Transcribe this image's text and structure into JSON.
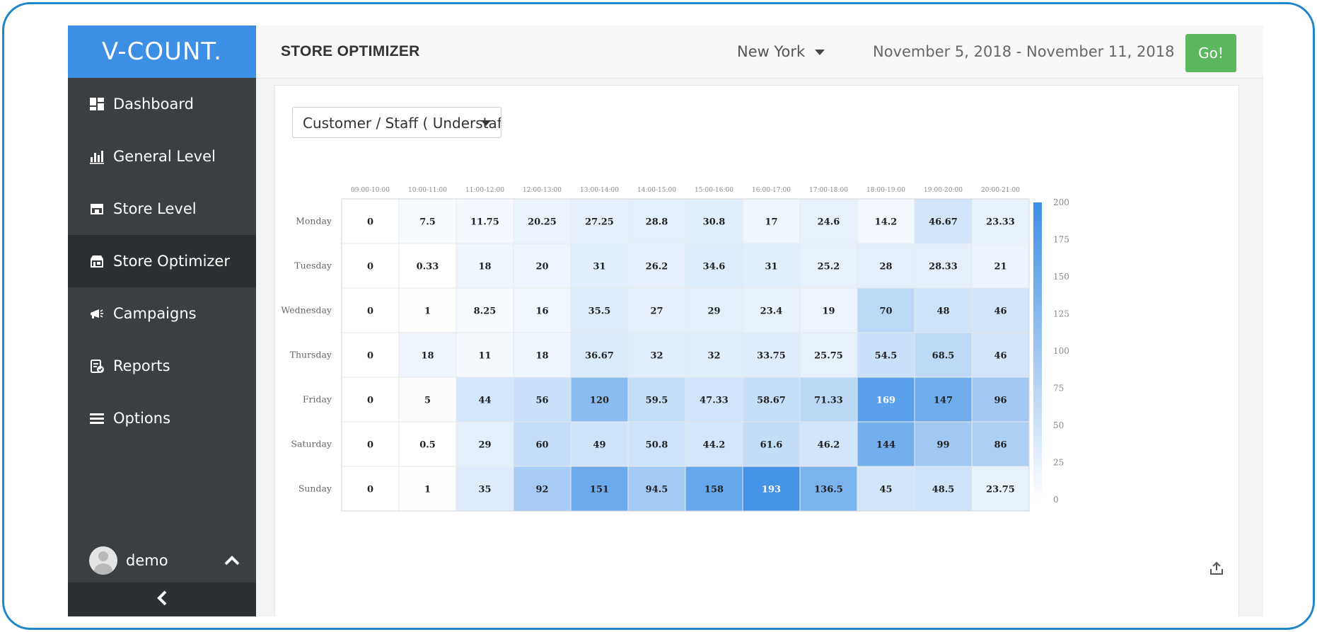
{
  "app": {
    "logo": "V-COUNT.",
    "title": "STORE OPTIMIZER",
    "location": "New York",
    "date_range": "November 5, 2018 - November 11, 2018",
    "go_label": "Go!"
  },
  "sidebar": {
    "items": [
      {
        "label": "Dashboard",
        "icon": "dashboard-icon"
      },
      {
        "label": "General Level",
        "icon": "bar-chart-icon"
      },
      {
        "label": "Store Level",
        "icon": "store-icon"
      },
      {
        "label": "Store Optimizer",
        "icon": "store-optimizer-icon",
        "active": true
      },
      {
        "label": "Campaigns",
        "icon": "megaphone-icon"
      },
      {
        "label": "Reports",
        "icon": "report-icon"
      },
      {
        "label": "Options",
        "icon": "menu-icon"
      }
    ],
    "user": "demo"
  },
  "controls": {
    "metric": "Customer / Staff ( Understaffed"
  },
  "colors": {
    "brand": "#3d8fe6",
    "go": "#5cb85c",
    "sidebar": "#3b3f42",
    "heat_min": "#ffffff",
    "heat_max": "#3d8fe6"
  },
  "chart_data": {
    "type": "heatmap",
    "x": [
      "09:00-10:00",
      "10:00-11:00",
      "11:00-12:00",
      "12:00-13:00",
      "13:00-14:00",
      "14:00-15:00",
      "15:00-16:00",
      "16:00-17:00",
      "17:00-18:00",
      "18:00-19:00",
      "19:00-20:00",
      "20:00-21:00"
    ],
    "y": [
      "Monday",
      "Tuesday",
      "Wednesday",
      "Thursday",
      "Friday",
      "Saturday",
      "Sunday"
    ],
    "values": [
      [
        0,
        7.5,
        11.75,
        20.25,
        27.25,
        28.8,
        30.8,
        17,
        24.6,
        14.2,
        46.67,
        23.33
      ],
      [
        0,
        0.33,
        18,
        20,
        31,
        26.2,
        34.6,
        31,
        25.2,
        28,
        28.33,
        21
      ],
      [
        0,
        1,
        8.25,
        16,
        35.5,
        27,
        29,
        23.4,
        19,
        70,
        48,
        46
      ],
      [
        0,
        18,
        11,
        18,
        36.67,
        32,
        32,
        33.75,
        25.75,
        54.5,
        68.5,
        46
      ],
      [
        0,
        5,
        44,
        56,
        120,
        59.5,
        47.33,
        58.67,
        71.33,
        169,
        147,
        96
      ],
      [
        0,
        0.5,
        29,
        60,
        49,
        50.8,
        44.2,
        61.6,
        46.2,
        144,
        99,
        86
      ],
      [
        0,
        1,
        35,
        92,
        151,
        94.5,
        158,
        193,
        136.5,
        45,
        48.5,
        23.75
      ]
    ],
    "color_range": [
      0,
      200
    ],
    "legend_ticks": [
      200,
      175,
      150,
      125,
      100,
      75,
      50,
      25,
      0
    ]
  }
}
